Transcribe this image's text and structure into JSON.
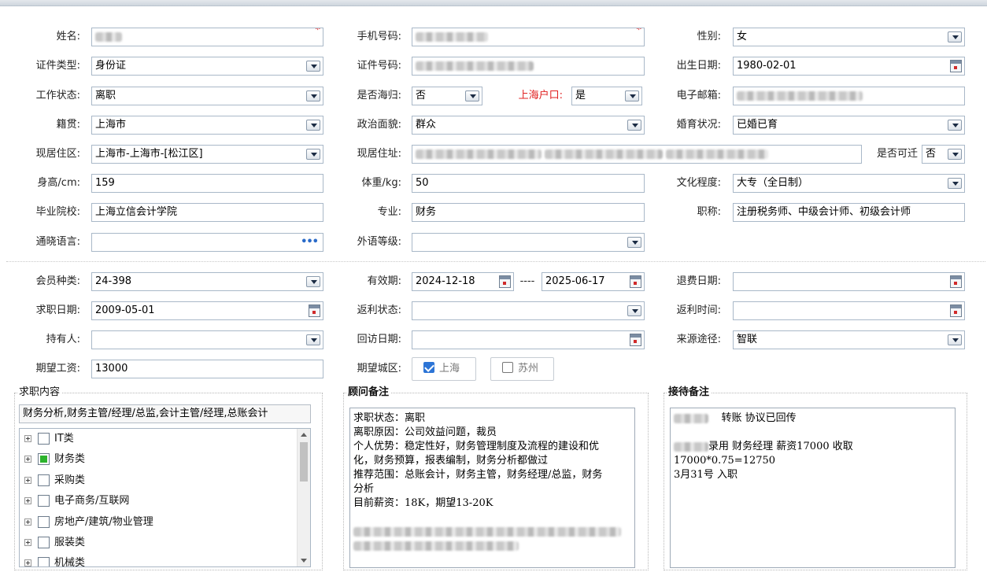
{
  "form": {
    "name_label": "姓名:",
    "phone_label": "手机号码:",
    "gender_label": "性别:",
    "gender_value": "女",
    "id_type_label": "证件类型:",
    "id_type_value": "身份证",
    "id_no_label": "证件号码:",
    "birth_label": "出生日期:",
    "birth_value": "1980-02-01",
    "work_status_label": "工作状态:",
    "work_status_value": "离职",
    "returnee_label": "是否海归:",
    "returnee_value": "否",
    "hukou_label": "上海户口:",
    "hukou_value": "是",
    "email_label": "电子邮箱:",
    "native_label": "籍贯:",
    "native_value": "上海市",
    "politics_label": "政治面貌:",
    "politics_value": "群众",
    "marital_label": "婚育状况:",
    "marital_value": "已婚已育",
    "district_label": "现居住区:",
    "district_value": "上海市-上海市-[松江区]",
    "address_label": "现居住址:",
    "relocate_label": "是否可迁",
    "relocate_value": "否",
    "height_label": "身高/cm:",
    "height_value": "159",
    "weight_label": "体重/kg:",
    "weight_value": "50",
    "education_label": "文化程度:",
    "education_value": "大专（全日制）",
    "school_label": "毕业院校:",
    "school_value": "上海立信会计学院",
    "major_label": "专业:",
    "major_value": "财务",
    "title_label": "职称:",
    "title_value": "注册税务师、中级会计师、初级会计师",
    "languages_label": "通晓语言:",
    "lang_level_label": "外语等级:"
  },
  "member": {
    "type_label": "会员种类:",
    "type_value": "24-398",
    "validity_label": "有效期:",
    "valid_from": "2024-12-18",
    "range_sep": "----",
    "valid_to": "2025-06-17",
    "refund_date_label": "退费日期:",
    "apply_date_label": "求职日期:",
    "apply_date_value": "2009-05-01",
    "rebate_status_label": "返利状态:",
    "rebate_time_label": "返利时间:",
    "holder_label": "持有人:",
    "revisit_label": "回访日期:",
    "source_label": "来源途径:",
    "source_value": "智联",
    "salary_label": "期望工资:",
    "salary_value": "13000",
    "city_label": "期望城区:",
    "city_shanghai": "上海",
    "city_suzhou": "苏州"
  },
  "jobs": {
    "title": "求职内容",
    "selected": "财务分析,财务主管/经理/总监,会计主管/经理,总账会计",
    "items": [
      "IT类",
      "财务类",
      "采购类",
      "电子商务/互联网",
      "房地产/建筑/物业管理",
      "服装类",
      "机械类"
    ]
  },
  "consultant": {
    "title": "顾问备注",
    "lines": [
      "求职状态：离职",
      "离职原因：公司效益问题，裁员",
      "个人优势：稳定性好，财务管理制度及流程的建设和优",
      "化，财务预算，报表编制，财务分析都做过",
      "推荐范围：总账会计，财务主管，财务经理/总监，财务",
      "分析",
      "目前薪资：18K，期望13-20K"
    ]
  },
  "reception": {
    "title": "接待备注",
    "line1": "转账 协议已回传",
    "line2": "录用 财务经理  薪资17000 收取",
    "line3": "17000*0.75=12750",
    "line4": "3月31号 入职"
  },
  "colors": {
    "required": "#e00000",
    "hukou_label": "#e02020",
    "checkbox_checked": "#2d75d6",
    "tree_partial": "#2db32d"
  }
}
